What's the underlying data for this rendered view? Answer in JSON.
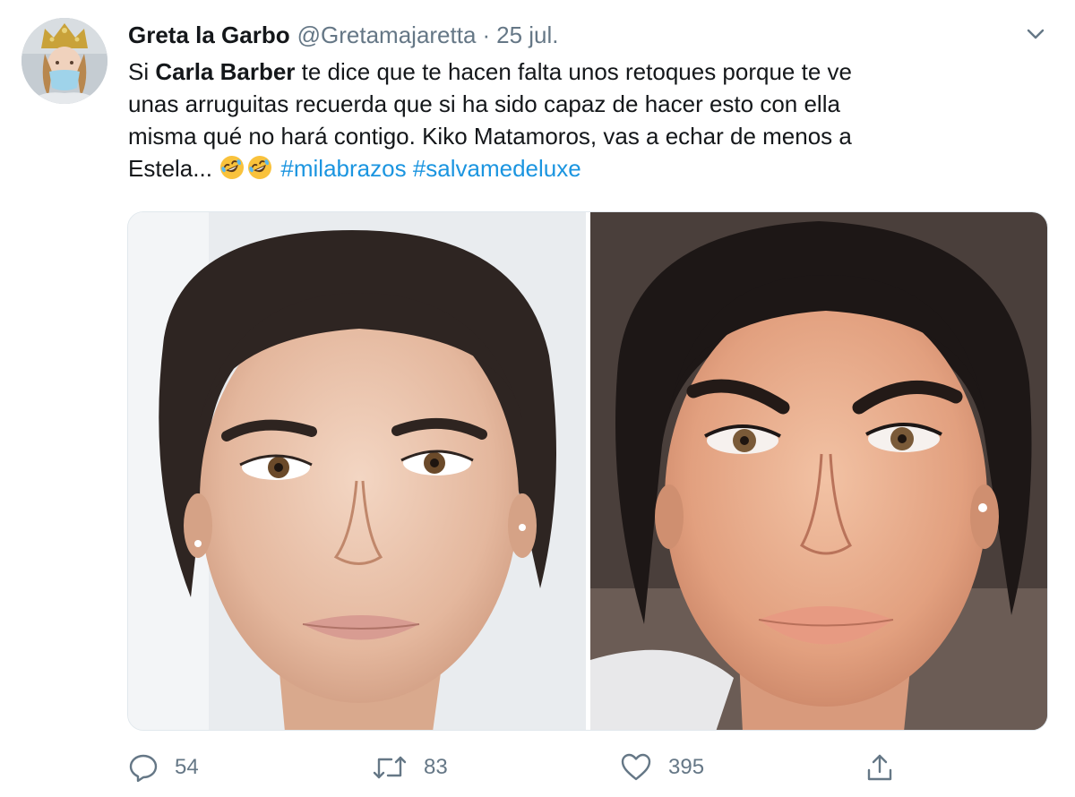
{
  "tweet": {
    "author": {
      "display_name": "Greta la Garbo",
      "handle": "@Gretamajaretta",
      "separator": "·",
      "date": "25 jul."
    },
    "text": {
      "line1_a": "Si ",
      "line1_bold": "Carla Barber",
      "line1_b": " te dice que te hacen falta unos retoques porque te ve",
      "line2": "unas arruguitas recuerda que si ha sido capaz de hacer esto con ella",
      "line3": "misma qué no hará contigo. Kiko Matamoros, vas a echar de menos  a",
      "line4": "Estela...",
      "emoji": "rolling-on-the-floor-laughing-icon",
      "hashtags": [
        "#milabrazos",
        "#salvamedeluxe"
      ]
    },
    "media": {
      "left_photo": "before-photo",
      "right_photo": "after-photo"
    },
    "actions": {
      "reply_count": "54",
      "retweet_count": "83",
      "like_count": "395"
    }
  },
  "colors": {
    "text": "#14171a",
    "secondary": "#657786",
    "link": "#1b95e0",
    "emoji": "#f9c23c"
  }
}
